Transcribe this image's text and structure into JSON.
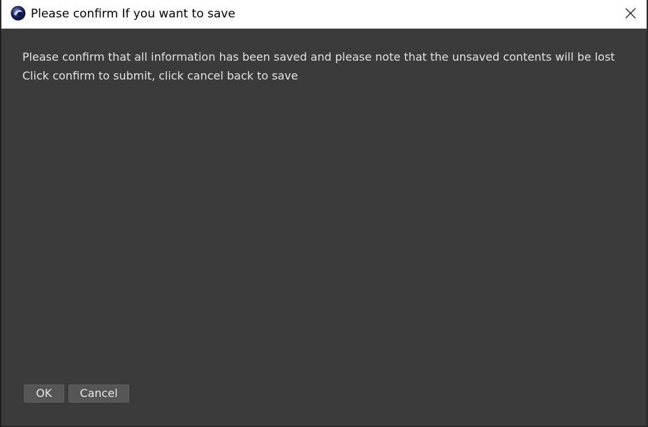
{
  "window": {
    "title": "Please confirm If you want to save",
    "app_icon": "cinema4d-logo-icon",
    "close_icon": "close-icon"
  },
  "message": {
    "line1": "Please confirm that all information has been saved and please note that the unsaved contents will be lost",
    "line2": "Click confirm to submit, click cancel back to save"
  },
  "buttons": {
    "ok_label": "OK",
    "cancel_label": "Cancel"
  },
  "colors": {
    "titlebar_bg": "#ffffff",
    "dialog_bg": "#3b3b3b",
    "text": "#e2e2e2",
    "button_bg": "#565656"
  }
}
